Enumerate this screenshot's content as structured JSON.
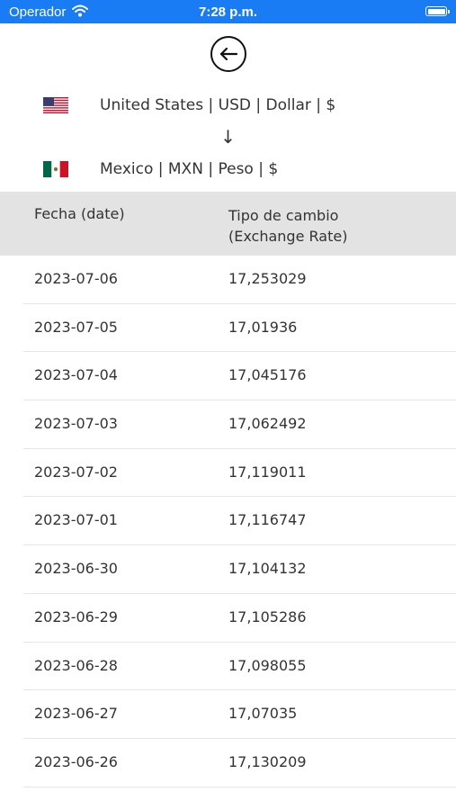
{
  "status_bar": {
    "carrier": "Operador",
    "time": "7:28 p.m."
  },
  "icons": {
    "back": "back-arrow-icon",
    "wifi": "wifi-icon",
    "battery": "battery-icon"
  },
  "colors": {
    "status_bar_bg": "#1a7cf5",
    "header_bg": "#e3e3e3"
  },
  "from_currency": {
    "label": "United States | USD | Dollar | $",
    "flag": "us-flag-icon"
  },
  "arrow": "↓",
  "to_currency": {
    "label": "Mexico | MXN | Peso | $",
    "flag": "mx-flag-icon"
  },
  "table": {
    "headers": {
      "date": "Fecha (date)",
      "rate_line1": "Tipo de cambio",
      "rate_line2": "(Exchange Rate)"
    },
    "rows": [
      {
        "date": "2023-07-06",
        "rate": "17,253029"
      },
      {
        "date": "2023-07-05",
        "rate": "17,01936"
      },
      {
        "date": "2023-07-04",
        "rate": "17,045176"
      },
      {
        "date": "2023-07-03",
        "rate": "17,062492"
      },
      {
        "date": "2023-07-02",
        "rate": "17,119011"
      },
      {
        "date": "2023-07-01",
        "rate": "17,116747"
      },
      {
        "date": "2023-06-30",
        "rate": "17,104132"
      },
      {
        "date": "2023-06-29",
        "rate": "17,105286"
      },
      {
        "date": "2023-06-28",
        "rate": "17,098055"
      },
      {
        "date": "2023-06-27",
        "rate": "17,07035"
      },
      {
        "date": "2023-06-26",
        "rate": "17,130209"
      }
    ]
  }
}
